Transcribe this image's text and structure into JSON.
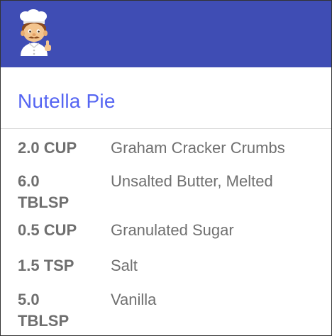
{
  "app_bar": {
    "color": "#3f4db4",
    "logo_icon": "chef-icon"
  },
  "recipe": {
    "title": "Nutella Pie",
    "title_color": "#5565f2"
  },
  "ingredients": [
    {
      "quantity": "2.0 CUP",
      "name": "Graham Cracker Crumbs"
    },
    {
      "quantity": "6.0 TBLSP",
      "name": "Unsalted Butter, Melted"
    },
    {
      "quantity": "0.5 CUP",
      "name": "Granulated Sugar"
    },
    {
      "quantity": "1.5 TSP",
      "name": "Salt"
    },
    {
      "quantity": "5.0 TBLSP",
      "name": "Vanilla"
    }
  ]
}
